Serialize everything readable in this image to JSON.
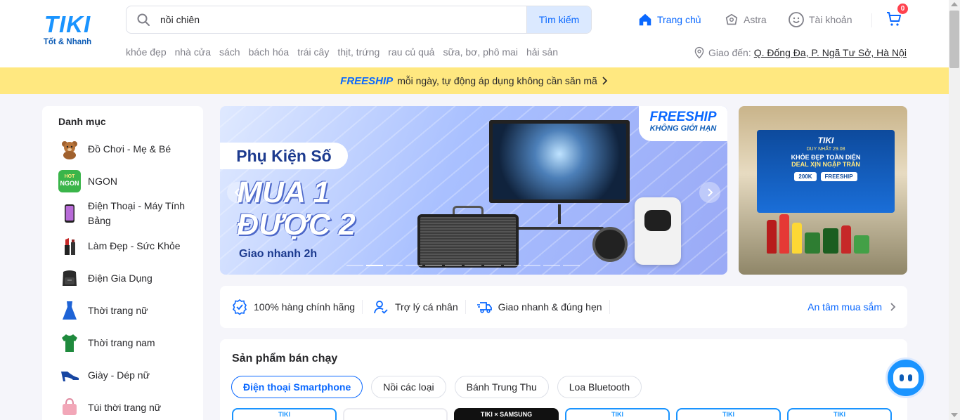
{
  "logo": {
    "mark": "TIKI",
    "tagline": "Tốt & Nhanh"
  },
  "search": {
    "value": "nồi chiên",
    "button": "Tìm kiếm"
  },
  "nav": {
    "home": "Trang chủ",
    "astra": "Astra",
    "account": "Tài khoản",
    "cart_count": "0"
  },
  "quick_links": [
    "khỏe đẹp",
    "nhà cửa",
    "sách",
    "bách hóa",
    "trái cây",
    "thịt, trứng",
    "rau củ quả",
    "sữa, bơ, phô mai",
    "hải sản"
  ],
  "delivery": {
    "label": "Giao đến:",
    "address": "Q. Đống Đa, P. Ngã Tư Sở, Hà Nội"
  },
  "freeship_bar": {
    "brand": "FREESHIP",
    "text": "mỗi ngày, tự động áp dụng không cần săn mã"
  },
  "sidebar": {
    "title": "Danh mục",
    "items": [
      {
        "label": "Đồ Chơi - Mẹ & Bé",
        "icon": "teddy-bear-icon"
      },
      {
        "label": "NGON",
        "icon": "ngon-icon"
      },
      {
        "label": "Điện Thoại - Máy Tính Bảng",
        "icon": "smartphone-icon"
      },
      {
        "label": "Làm Đẹp - Sức Khỏe",
        "icon": "lipstick-icon"
      },
      {
        "label": "Điện Gia Dụng",
        "icon": "air-fryer-icon"
      },
      {
        "label": "Thời trang nữ",
        "icon": "dress-icon"
      },
      {
        "label": "Thời trang nam",
        "icon": "tshirt-icon"
      },
      {
        "label": "Giày - Dép nữ",
        "icon": "high-heel-icon"
      },
      {
        "label": "Túi thời trang nữ",
        "icon": "handbag-icon"
      }
    ],
    "ngon_badge_top": "HOT",
    "ngon_badge_main": "NGON"
  },
  "banner": {
    "tag": "Phụ Kiện Số",
    "headline_1": "MUA 1",
    "headline_2": "ĐƯỢC 2",
    "sub": "Giao nhanh 2h",
    "badge_1": "FREESHIP",
    "badge_2": "KHÔNG GIỚI HẠN",
    "slide_count": 12,
    "active_slide": 2
  },
  "side_banner": {
    "brand": "TIKI",
    "line_1": "DUY NHẤT 29.08",
    "line_2": "KHỎE ĐẸP TOÀN DIỆN",
    "line_3": "DEAL XỊN NGẬP TRÀN",
    "pill_1": "200K",
    "pill_2": "FREESHIP"
  },
  "assurance": {
    "items": [
      {
        "label": "100% hàng chính hãng",
        "icon": "shield-check-icon"
      },
      {
        "label": "Trợ lý cá nhân",
        "icon": "personal-assistant-icon"
      },
      {
        "label": "Giao nhanh & đúng hẹn",
        "icon": "fast-delivery-icon"
      }
    ],
    "link": "An tâm mua sắm"
  },
  "best_sellers": {
    "title": "Sản phẩm bán chạy",
    "chips": [
      "Điện thoại Smartphone",
      "Nồi các loại",
      "Bánh Trung Thu",
      "Loa Bluetooth"
    ],
    "active_chip": 0,
    "thumb_labels": [
      "TIKI",
      "",
      "TIKI × SAMSUNG",
      "TIKI",
      "TIKI",
      "TIKI"
    ]
  },
  "colors": {
    "brand": "#1a94ff",
    "primary": "#0a68ff",
    "freeship_bg": "#ffe880",
    "badge": "#ff424e"
  }
}
